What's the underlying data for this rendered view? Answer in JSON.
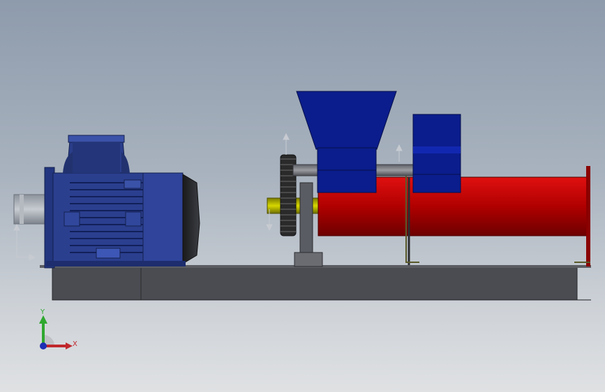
{
  "viewport": {
    "background_top": "#8e9bac",
    "background_bottom": "#dfe1e3"
  },
  "model": {
    "motor": {
      "color": "#2b3f8f",
      "icon": "electric-motor"
    },
    "base": {
      "color": "#4a4c52"
    },
    "hopper": {
      "color": "#0b1d8c"
    },
    "barrel": {
      "color": "#c00000"
    },
    "gear": {
      "color": "#2a2a2a",
      "icon": "spur-gear"
    },
    "shaft": {
      "color": "#c9c900"
    }
  },
  "triad": {
    "y_label": "Y",
    "x_label": "X",
    "y_color": "#2fa82f",
    "x_color": "#c0282d",
    "z_color": "#1d2fb4"
  }
}
